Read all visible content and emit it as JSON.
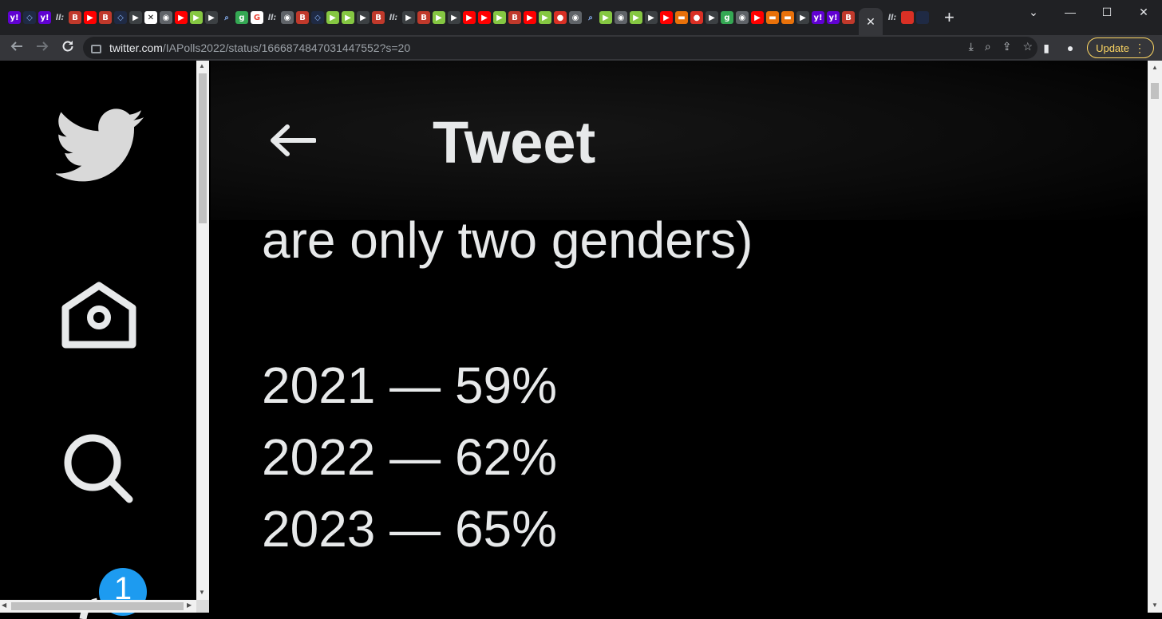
{
  "browser": {
    "active_tab_close": "✕",
    "new_tab": "+",
    "window_controls": {
      "minimize": "—",
      "maximize": "☐",
      "close": "✕",
      "dropdown": "⌄"
    },
    "url": {
      "host": "twitter.com",
      "path": "/IAPolls2022/status/1666874847031447552?s=20"
    },
    "update_label": "Update",
    "favicons": [
      "yahoo",
      "shield",
      "yahoo",
      "ll",
      "bi",
      "yt",
      "bi",
      "shield",
      "dark",
      "sheet",
      "globe",
      "yt",
      "rumble",
      "dark",
      "srch",
      "green",
      "g",
      "ll",
      "globe",
      "bi",
      "shield",
      "rumble",
      "rumble",
      "dark",
      "bi",
      "ll",
      "dark",
      "bi",
      "rumble",
      "dark",
      "yt",
      "yt",
      "rumble",
      "bi",
      "yt",
      "rumble",
      "mic",
      "globe",
      "srch",
      "rumble",
      "globe",
      "rumble",
      "dark",
      "yt",
      "flag",
      "mic",
      "dark",
      "green",
      "globe",
      "yt",
      "flag",
      "flag",
      "dark",
      "yahoo",
      "yahoo",
      "bi"
    ]
  },
  "sidebar": {
    "badge_count": "1"
  },
  "header": {
    "title": "Tweet"
  },
  "tweet": {
    "lines": [
      "are only two genders)",
      "2021 — 59%",
      "2022 — 62%",
      "2023 — 65%"
    ]
  }
}
